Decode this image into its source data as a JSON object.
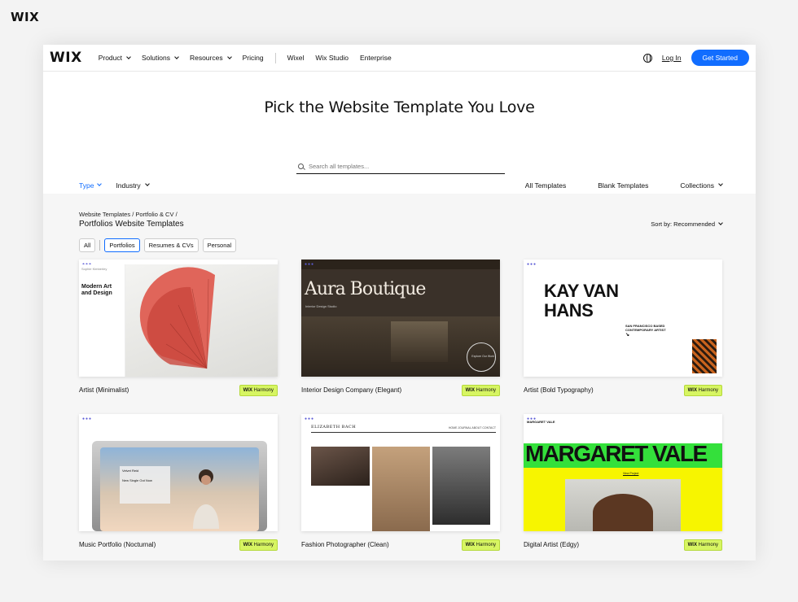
{
  "corner_brand": "WIX",
  "nav": {
    "logo": "WIX",
    "menu": [
      {
        "label": "Product",
        "dropdown": true
      },
      {
        "label": "Solutions",
        "dropdown": true
      },
      {
        "label": "Resources",
        "dropdown": true
      },
      {
        "label": "Pricing",
        "dropdown": false
      }
    ],
    "menu2": [
      "Wixel",
      "Wix Studio",
      "Enterprise"
    ],
    "login": "Log In",
    "cta": "Get Started"
  },
  "hero": {
    "title": "Pick the Website Template You Love",
    "search_placeholder": "Search all templates..."
  },
  "filters": {
    "type": "Type",
    "industry": "Industry",
    "all_templates": "All Templates",
    "blank_templates": "Blank Templates",
    "collections": "Collections"
  },
  "breadcrumb": {
    "items": [
      "Website Templates",
      "Portfolio & CV"
    ],
    "separator": "/"
  },
  "page_heading": "Portfolios Website Templates",
  "sort": {
    "label": "Sort by:",
    "value": "Recommended"
  },
  "chips": [
    {
      "label": "All",
      "active": false
    },
    {
      "label": "Portfolios",
      "active": true
    },
    {
      "label": "Resumes & CVs",
      "active": false
    },
    {
      "label": "Personal",
      "active": false
    }
  ],
  "badge": {
    "brand": "WIX",
    "word": "Harmony"
  },
  "templates": [
    {
      "name": "Artist (Minimalist)",
      "thumb_text": "Modern Art and Design",
      "thumb_side": "Sophie Kimberley"
    },
    {
      "name": "Interior Design Company (Elegant)",
      "thumb_text": "Aura Boutique",
      "thumb_sub": "Interior Design Studio",
      "thumb_cta": "Explore Our Work"
    },
    {
      "name": "Artist (Bold Typography)",
      "thumb_text": "KAY VAN HANS",
      "thumb_sub": "SAN FRANCISCO BASED CONTEMPORARY ARTIST"
    },
    {
      "name": "Music Portfolio (Nocturnal)",
      "thumb_text": "Velvet Reid",
      "thumb_sub": "New Single Out Now"
    },
    {
      "name": "Fashion Photographer (Clean)",
      "thumb_text": "ELIZABETH BACH",
      "thumb_menu": "HOME  JOURNAL  ABOUT  CONTACT"
    },
    {
      "name": "Digital Artist (Edgy)",
      "thumb_text": "MARGARET VALE",
      "thumb_top": "MARGARET VALE",
      "thumb_link": "View Project"
    }
  ],
  "colors": {
    "accent": "#116dff",
    "harmony_badge": "#d7f562",
    "content_bg": "#f6f6f6"
  }
}
